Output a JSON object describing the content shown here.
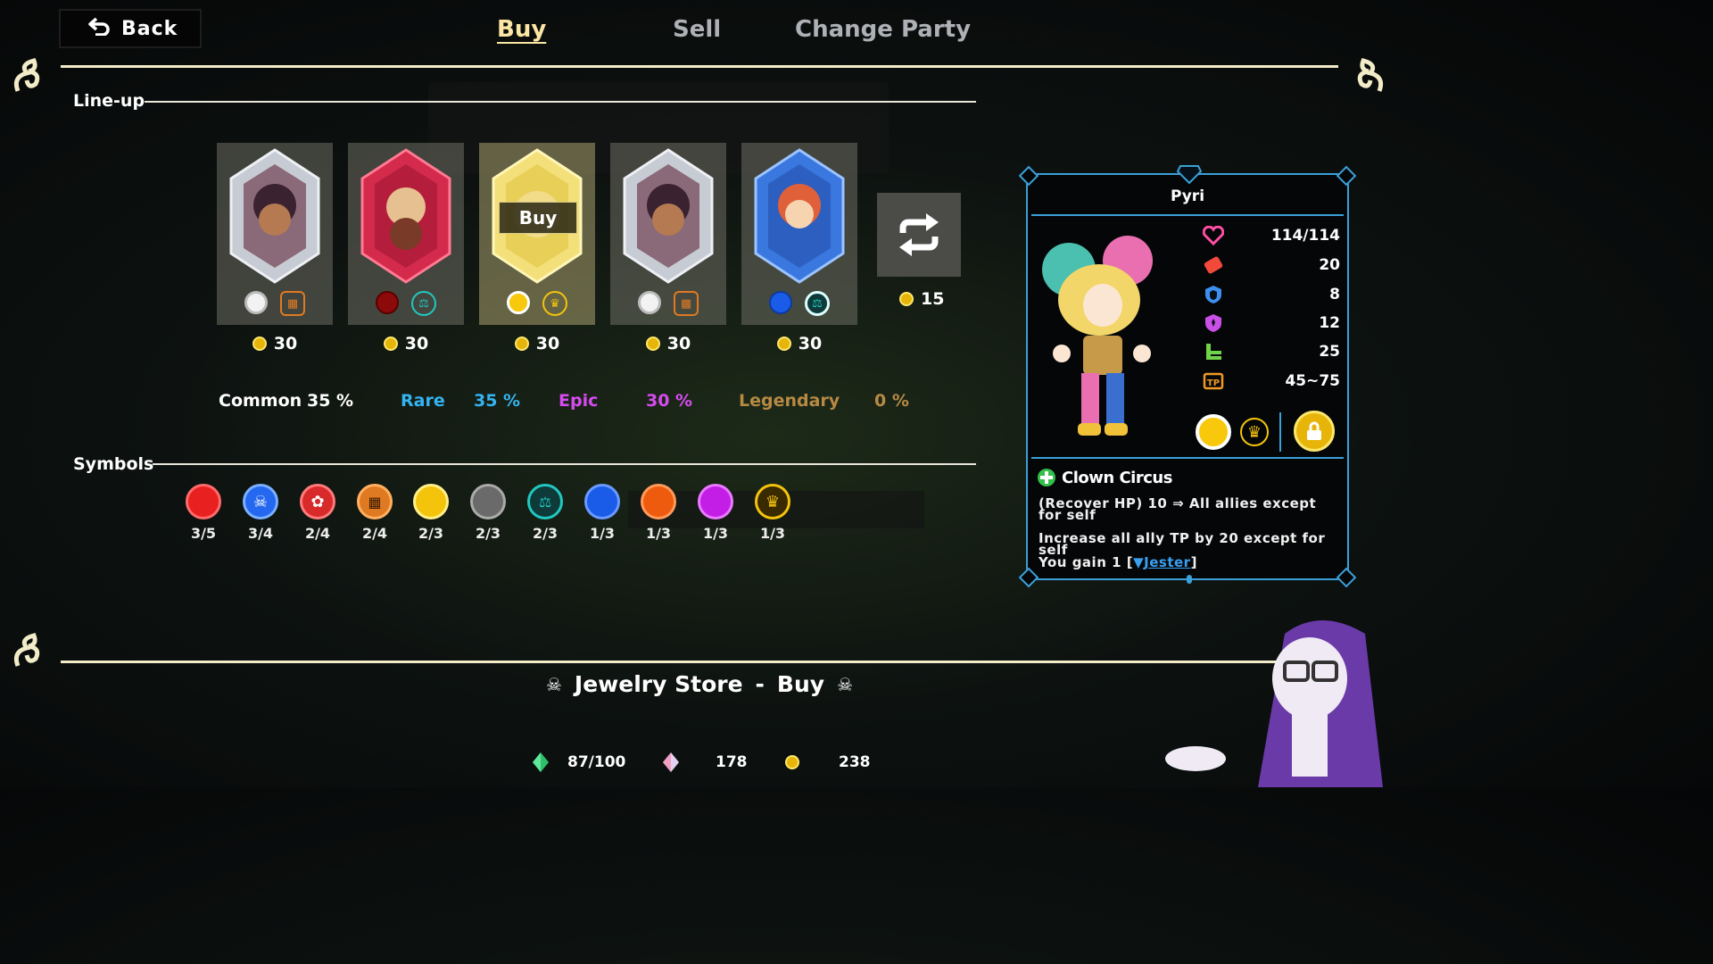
{
  "header": {
    "back_label": "Back",
    "tabs": [
      {
        "label": "Buy",
        "active": true
      },
      {
        "label": "Sell",
        "active": false
      },
      {
        "label": "Change Party",
        "active": false
      }
    ]
  },
  "lineup": {
    "label": "Line-up",
    "cards": [
      {
        "price": "30",
        "rarity_color": "#f2f2f2",
        "symbol": "orange-helmet"
      },
      {
        "price": "30",
        "rarity_color": "#8c0a0a",
        "symbol": "teal-scales"
      },
      {
        "price": "30",
        "rarity_color": "#f7c80c",
        "symbol": "gold-crown",
        "hover_label": "Buy"
      },
      {
        "price": "30",
        "rarity_color": "#f2f2f2",
        "symbol": "orange-helmet"
      },
      {
        "price": "30",
        "rarity_color": "#1a5ce8",
        "symbol": "teal-scales"
      }
    ],
    "refresh_cost": "15"
  },
  "rarities": [
    {
      "name": "Common",
      "pct": "35 %",
      "color": "#ffffff"
    },
    {
      "name": "Rare",
      "pct": "35 %",
      "color": "#35b3f0"
    },
    {
      "name": "Epic",
      "pct": "30 %",
      "color": "#d64bf0"
    },
    {
      "name": "Legendary",
      "pct": "0 %",
      "color": "#b78a43"
    }
  ],
  "symbols": {
    "label": "Symbols",
    "items": [
      {
        "count": "3/5",
        "color": "#e82020"
      },
      {
        "count": "3/4",
        "color": "#2468f0"
      },
      {
        "count": "2/4",
        "color": "#d82a2a"
      },
      {
        "count": "2/4",
        "color": "#e07a22"
      },
      {
        "count": "2/3",
        "color": "#f4c40c"
      },
      {
        "count": "2/3",
        "color": "#6a6a6a"
      },
      {
        "count": "2/3",
        "color": "#21c8c0"
      },
      {
        "count": "1/3",
        "color": "#1a5ce8"
      },
      {
        "count": "1/3",
        "color": "#ee5a0e"
      },
      {
        "count": "1/3",
        "color": "#c21ee6"
      },
      {
        "count": "1/3",
        "color": "#f4c40c"
      }
    ]
  },
  "character": {
    "name": "Pyri",
    "stats": [
      {
        "icon": "heart-icon",
        "value": "114/114",
        "color": "#ff4fa5"
      },
      {
        "icon": "attack-icon",
        "value": "20",
        "color": "#f24a3a"
      },
      {
        "icon": "shield-icon",
        "value": "8",
        "color": "#3d8ff0"
      },
      {
        "icon": "magic-shield-icon",
        "value": "12",
        "color": "#c94fe6"
      },
      {
        "icon": "speed-icon",
        "value": "25",
        "color": "#70d44a"
      },
      {
        "icon": "tp-icon",
        "value": "45~75",
        "color": "#f09a25"
      }
    ],
    "skill_name": "Clown Circus",
    "skill_lines": [
      "(Recover HP) 10 ⇒ All allies except for self",
      "Increase all ally TP by 20 except for self"
    ],
    "gain_prefix": "You gain 1 [",
    "gain_link": "Jester",
    "gain_suffix": "]"
  },
  "footer": {
    "store": "Jewelry Store",
    "sep": "-",
    "mode": "Buy",
    "resources": [
      {
        "icon": "green-crystal-icon",
        "value": "87/100"
      },
      {
        "icon": "prism-shard-icon",
        "value": "178"
      },
      {
        "icon": "coin-icon",
        "value": "238"
      }
    ]
  },
  "colors": {
    "accent": "#3aa0d8",
    "gold": "#e7b40a",
    "cream": "#f3ecc8"
  }
}
